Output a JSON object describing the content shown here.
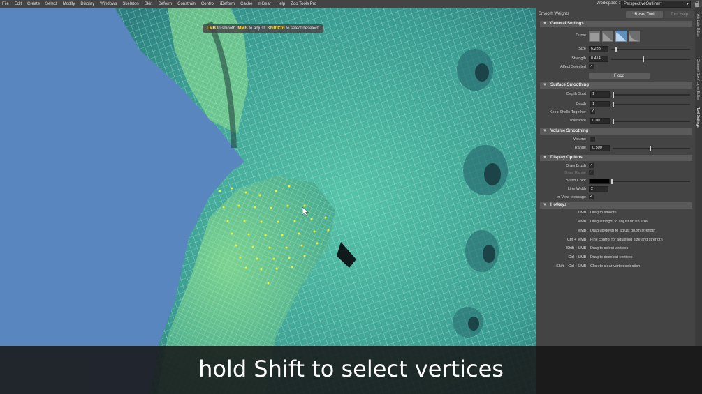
{
  "menubar": {
    "items": [
      "File",
      "Edit",
      "Create",
      "Select",
      "Modify",
      "Display",
      "Windows",
      "Skeleton",
      "Skin",
      "Deform",
      "Constrain",
      "Control",
      "iDeform",
      "Cache",
      "mGear",
      "Help",
      "Zoo Tools Pro"
    ],
    "workspace_label": "Workspace :",
    "workspace_value": "PerspectiveOutliner*"
  },
  "viewport": {
    "help_lmb": "LMB",
    "help_smooth": " to smooth. ",
    "help_mmb": "MMB",
    "help_adjust": " to adjust. ",
    "help_shift": "Shift/Ctrl",
    "help_select": " to select/deselect."
  },
  "panel": {
    "title": "Smooth Weights",
    "reset_tool": "Reset Tool",
    "tool_help": "Tool Help",
    "general": {
      "title": "General Settings",
      "curve_label": "Curve",
      "size_label": "Size",
      "size_value": "6.233",
      "size_slider": 0.05,
      "strength_label": "Strength",
      "strength_value": "0.414",
      "strength_slider": 0.41,
      "affect_label": "Affect Selected",
      "affect_checked": true,
      "flood_label": "Flood"
    },
    "surface": {
      "title": "Surface Smoothing",
      "depth_start_label": "Depth Start",
      "depth_start_value": "1",
      "depth_label": "Depth",
      "depth_value": "1",
      "keep_shells_label": "Keep Shells Together",
      "tolerance_label": "Tolerance",
      "tolerance_value": "0.001"
    },
    "volume": {
      "title": "Volume Smoothing",
      "volume_label": "Volume",
      "range_label": "Range",
      "range_value": "0.500",
      "range_slider": 0.5
    },
    "display": {
      "title": "Display Options",
      "draw_brush_label": "Draw Brush",
      "draw_range_label": "Draw Range",
      "brush_color_label": "Brush Color",
      "brush_color": "#000000",
      "line_width_label": "Line Width",
      "line_width_value": "2",
      "inview_label": "In-View Message"
    },
    "hotkeys": {
      "title": "Hotkeys",
      "rows": [
        {
          "key": "LMB:",
          "desc": "Drag to smooth"
        },
        {
          "key": "MMB:",
          "desc": "Drag left/right to adjust brush size"
        },
        {
          "key": "MMB:",
          "desc": "Drag up/down to adjust brush strength"
        },
        {
          "key": "Ctrl + MMB:",
          "desc": "Fine control for adjusting size and strength"
        },
        {
          "key": "Shift + LMB:",
          "desc": "Drag to select vertices"
        },
        {
          "key": "Ctrl + LMB:",
          "desc": "Drag to deselect vertices"
        },
        {
          "key": "Shift + Ctrl + LMB:",
          "desc": "Click to clear vertex selection"
        }
      ]
    }
  },
  "side_tabs": [
    "Attribute Editor",
    "Channel Box / Layer Editor",
    "Tool Settings"
  ],
  "subtitle": "hold Shift to select vertices",
  "colors": {
    "mesh_fill": "#3fa89a",
    "mesh_wire": "#bff2ea",
    "selected_vertex": "#f2ee3a",
    "background": "#5a86c0"
  }
}
